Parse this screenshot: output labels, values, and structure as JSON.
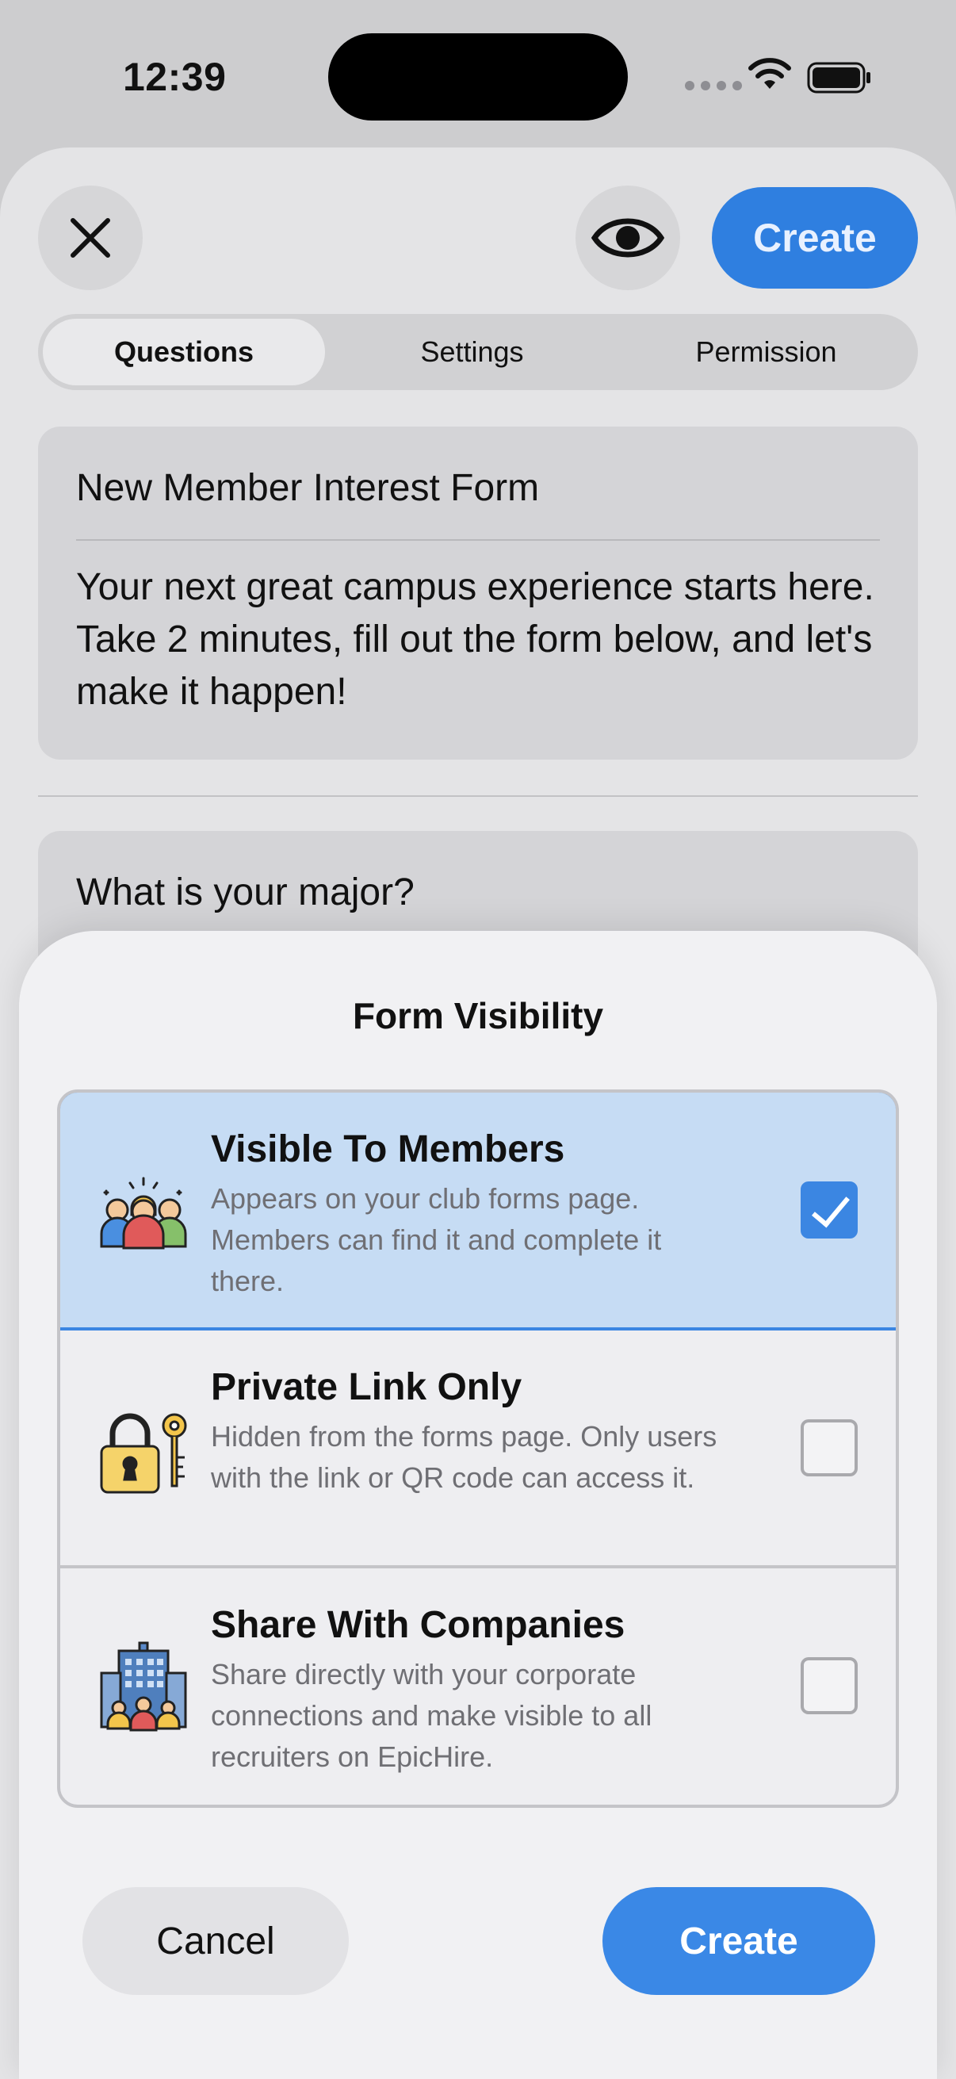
{
  "status_bar": {
    "time": "12:39"
  },
  "header": {
    "create_label": "Create"
  },
  "tabs": [
    {
      "label": "Questions",
      "active": true
    },
    {
      "label": "Settings",
      "active": false
    },
    {
      "label": "Permission",
      "active": false
    }
  ],
  "form": {
    "title": "New Member Interest Form",
    "description": "Your next great campus experience starts here. Take 2 minutes, fill out the form below, and let's make it happen!",
    "question_1": "What is your major?"
  },
  "visibility_sheet": {
    "title": "Form Visibility",
    "options": [
      {
        "title": "Visible To Members",
        "description": "Appears on your club forms page. Members can find it and complete it there.",
        "icon": "members-group-icon",
        "selected": true
      },
      {
        "title": "Private Link Only",
        "description": "Hidden from the forms page. Only users with the link or QR code can access it.",
        "icon": "lock-key-icon",
        "selected": false
      },
      {
        "title": "Share With Companies",
        "description": "Share directly with your corporate connections and make visible to all recruiters on EpicHire.",
        "icon": "building-people-icon",
        "selected": false
      }
    ],
    "cancel_label": "Cancel",
    "create_label": "Create"
  },
  "colors": {
    "accent": "#3a88e6",
    "selected_bg": "#c6dcf4"
  }
}
